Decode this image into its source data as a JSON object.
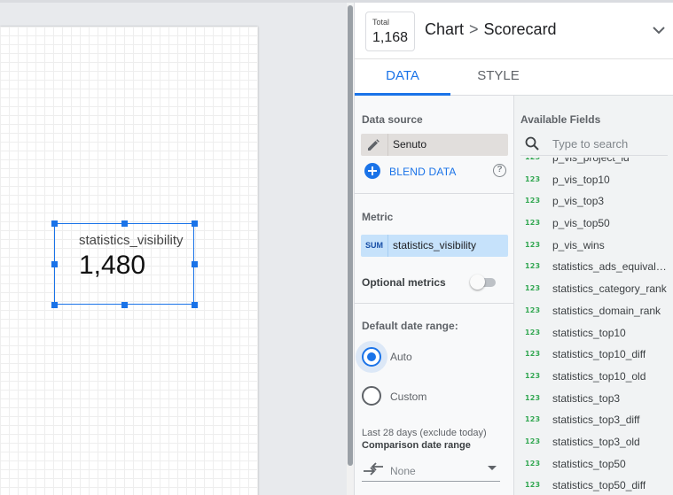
{
  "scorecard": {
    "label": "statistics_visibility",
    "value": "1,480"
  },
  "header": {
    "total_label": "Total",
    "total_value": "1,168",
    "breadcrumb_1": "Chart",
    "breadcrumb_sep": ">",
    "breadcrumb_2": "Scorecard",
    "expand_icon": "chevron-down-icon"
  },
  "tabs": [
    {
      "label": "DATA",
      "active": true
    },
    {
      "label": "STYLE",
      "active": false
    }
  ],
  "data_panel": {
    "data_source_title": "Data source",
    "data_source_name": "Senuto",
    "blend_label": "BLEND DATA",
    "help_glyph": "?",
    "metric_title": "Metric",
    "metric_agg": "SUM",
    "metric_name": "statistics_visibility",
    "optional_metrics_label": "Optional metrics",
    "optional_metrics_enabled": false,
    "date_range_title": "Default date range:",
    "date_options": [
      {
        "label": "Auto",
        "selected": true
      },
      {
        "label": "Custom",
        "selected": false
      }
    ],
    "date_note": "Last 28 days (exclude today)",
    "comparison_title": "Comparison date range",
    "comparison_value": "None"
  },
  "available_fields": {
    "title": "Available Fields",
    "search_placeholder": "Type to search",
    "type_badge": "123",
    "fields": [
      "p_vis_project_id",
      "p_vis_top10",
      "p_vis_top3",
      "p_vis_top50",
      "p_vis_wins",
      "statistics_ads_equivalent",
      "statistics_category_rank",
      "statistics_domain_rank",
      "statistics_top10",
      "statistics_top10_diff",
      "statistics_top10_old",
      "statistics_top3",
      "statistics_top3_diff",
      "statistics_top3_old",
      "statistics_top50",
      "statistics_top50_diff"
    ]
  },
  "colors": {
    "accent": "#1a73e8",
    "metric_chip": "#c6e2fb",
    "datasource_chip": "#e1dedc",
    "number_type": "#34a853"
  }
}
